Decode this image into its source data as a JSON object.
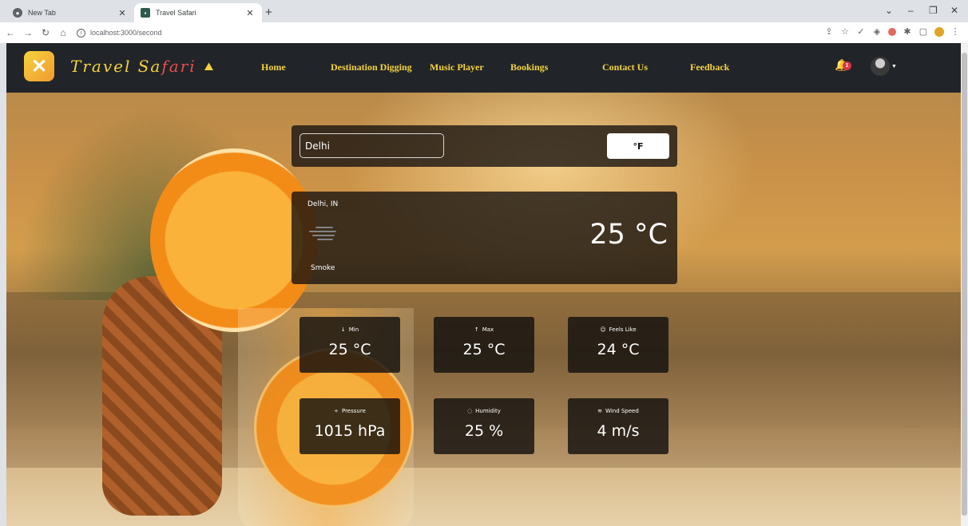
{
  "browser": {
    "tabs": [
      {
        "title": "New Tab"
      },
      {
        "title": "Travel Safari"
      }
    ],
    "url": "localhost:3000/second"
  },
  "navbar": {
    "brand_part1": "Travel Sa",
    "brand_part2": "fari",
    "links": [
      "Home",
      "Destination Digging",
      "Music Player",
      "Bookings",
      "Contact Us",
      "Feedback"
    ],
    "notification_count": "1"
  },
  "weather": {
    "city_value": "Delhi",
    "unit_toggle_label": "°F",
    "location": "Delhi, IN",
    "condition": "Smoke",
    "temperature": "25 °C",
    "stats": [
      {
        "label": "Min",
        "value": "25 °C",
        "icon": "arrow-down-icon"
      },
      {
        "label": "Max",
        "value": "25 °C",
        "icon": "arrow-up-icon"
      },
      {
        "label": "Feels Like",
        "value": "24 °C",
        "icon": "smile-icon"
      },
      {
        "label": "Pressure",
        "value": "1015 hPa",
        "icon": "pressure-icon"
      },
      {
        "label": "Humidity",
        "value": "25 %",
        "icon": "droplet-icon"
      },
      {
        "label": "Wind Speed",
        "value": "4 m/s",
        "icon": "wind-icon"
      }
    ]
  },
  "colors": {
    "navbar_bg": "#212529",
    "nav_link": "#f6d33c",
    "brand_accent": "#e94d4d",
    "badge": "#dc3545"
  }
}
